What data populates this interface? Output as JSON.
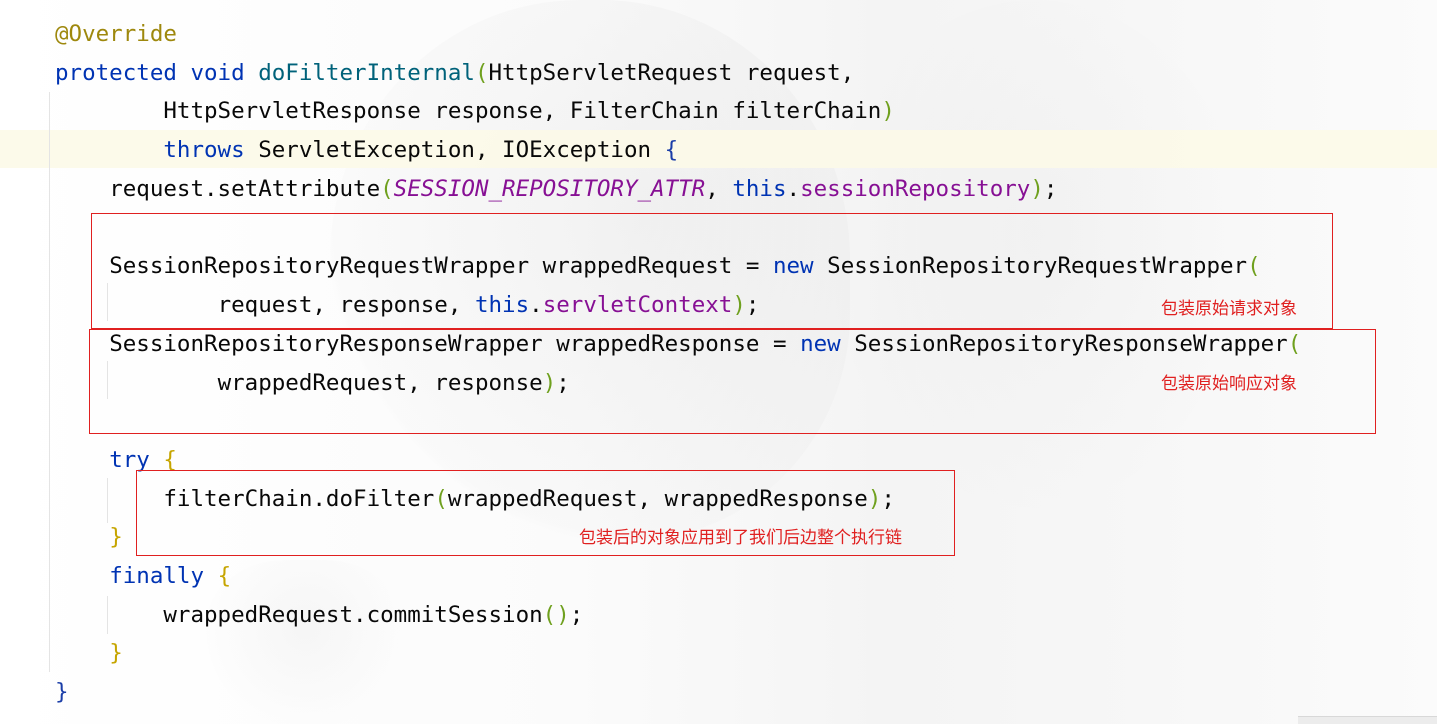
{
  "code": {
    "annotation": "@Override",
    "kw_protected": "protected",
    "kw_void": "void",
    "method_name": "doFilterInternal",
    "type_request": "HttpServletRequest",
    "param_request": "request",
    "type_response": "HttpServletResponse",
    "param_response": "response",
    "type_chain": "FilterChain",
    "param_chain": "filterChain",
    "kw_throws": "throws",
    "exceptions": "ServletException, IOException",
    "set_attribute_call": "request.setAttribute",
    "const_attr": "SESSION_REPOSITORY_ATTR",
    "kw_this": "this",
    "field_session_repo": "sessionRepository",
    "type_req_wrapper": "SessionRepositoryRequestWrapper",
    "var_wrapped_request": "wrappedRequest",
    "kw_new": "new",
    "field_servlet_context": "servletContext",
    "type_resp_wrapper": "SessionRepositoryResponseWrapper",
    "var_wrapped_response": "wrappedResponse",
    "kw_try": "try",
    "do_filter_call": "filterChain.doFilter",
    "kw_finally": "finally",
    "commit_call": "wrappedRequest.commitSession"
  },
  "notes": {
    "wrap_request": "包装原始请求对象",
    "wrap_response": "包装原始响应对象",
    "apply_chain": "包装后的对象应用到了我们后边整个执行链"
  },
  "colors": {
    "keyword": "#0033b3",
    "annotation": "#9e880d",
    "method": "#00627a",
    "constant": "#871094",
    "highlight_box": "#e02020"
  }
}
